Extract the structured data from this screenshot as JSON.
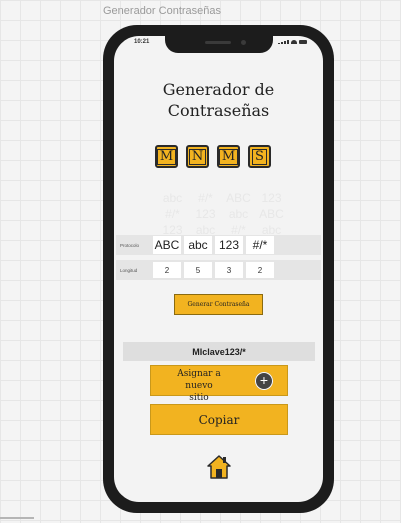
{
  "canvas": {
    "title": "Generador Contraseñas"
  },
  "status_bar": {
    "time": "10:21"
  },
  "app": {
    "title_line1": "Generador de",
    "title_line2": "Contraseñas",
    "letter_buttons": [
      "M",
      "N",
      "M",
      "S"
    ],
    "preview_grid": [
      [
        "abc",
        "#/*",
        "ABC",
        "123"
      ],
      [
        "#/*",
        "123",
        "abc",
        "ABC"
      ],
      [
        "123",
        "abc",
        "#/*",
        "abc"
      ]
    ],
    "protocol_row": {
      "label": "Protocolo",
      "cells": [
        "ABC",
        "abc",
        "123",
        "#/*"
      ]
    },
    "length_row": {
      "label": "Longitud",
      "values": [
        "2",
        "5",
        "3",
        "2"
      ]
    },
    "generate_label": "Generar Contraseña",
    "password": "MIclave123/*",
    "assign_label_line1": "Asignar a",
    "assign_label_line2": "nuevo sitio",
    "copy_label": "Copiar"
  },
  "icons": {
    "assign": "plus-icon",
    "home": "home-icon"
  },
  "colors": {
    "accent": "#f2b320",
    "frame": "#1c1c1c",
    "screen": "#f3f3f3"
  }
}
